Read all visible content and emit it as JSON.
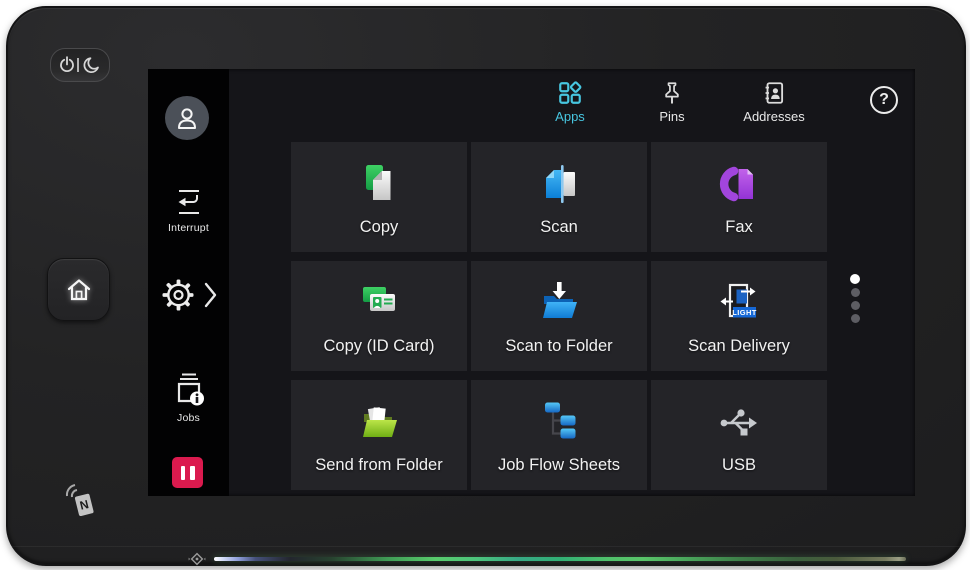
{
  "header": {
    "tabs": [
      {
        "label": "Apps",
        "active": true
      },
      {
        "label": "Pins",
        "active": false
      },
      {
        "label": "Addresses",
        "active": false
      }
    ],
    "help": "?"
  },
  "sidebar": {
    "interrupt_label": "Interrupt",
    "jobs_label": "Jobs"
  },
  "apps": [
    {
      "label": "Copy"
    },
    {
      "label": "Scan"
    },
    {
      "label": "Fax"
    },
    {
      "label": "Copy (ID Card)"
    },
    {
      "label": "Scan to Folder"
    },
    {
      "label": "Scan Delivery",
      "badge": "LIGHT"
    },
    {
      "label": "Send from Folder"
    },
    {
      "label": "Job Flow Sheets"
    },
    {
      "label": "USB"
    }
  ],
  "nfc_tag_letter": "N",
  "page_indicator": {
    "dot_count": 4,
    "active_index": 0
  },
  "colors": {
    "accent_cyan": "#47C6E0",
    "pause_red": "#DB1A4E",
    "tile_bg": "#242428",
    "screen_bg": "#151519",
    "sidebar_bg": "#020203",
    "led_green": "#50C26B"
  }
}
